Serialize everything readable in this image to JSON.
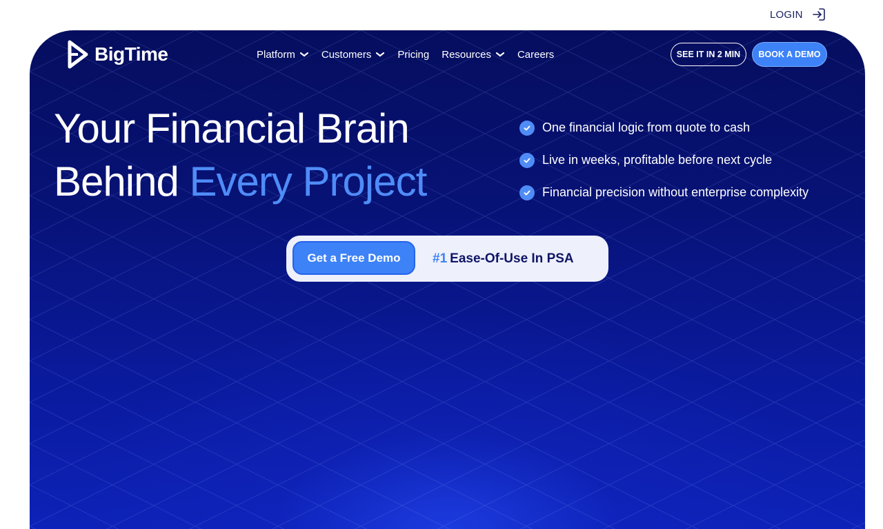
{
  "topbar": {
    "login_label": "LOGIN",
    "login_icon": "login-arrow-icon"
  },
  "brand": {
    "name": "BigTime",
    "logo_icon": "bigtime-play-logo-icon"
  },
  "nav": {
    "items": [
      {
        "label": "Platform",
        "has_dropdown": true
      },
      {
        "label": "Customers",
        "has_dropdown": true
      },
      {
        "label": "Pricing",
        "has_dropdown": false
      },
      {
        "label": "Resources",
        "has_dropdown": true
      },
      {
        "label": "Careers",
        "has_dropdown": false
      }
    ],
    "see_it_label": "SEE IT IN 2 MIN",
    "book_demo_label": "BOOK A DEMO"
  },
  "hero": {
    "headline_line1": "Your Financial Brain",
    "headline_line2_plain": "Behind ",
    "headline_line2_accent": "Every Project",
    "checklist": [
      "One financial logic from quote to cash",
      "Live in weeks, profitable before next cycle",
      "Financial precision without enterprise complexity"
    ],
    "cta_button_label": "Get a Free Demo",
    "badge_rank": "#1",
    "badge_text": "Ease-Of-Use In PSA"
  },
  "colors": {
    "hero_bg": "#071276",
    "accent": "#4f8cf7",
    "button_blue": "#3d82f7",
    "navy_text": "#0f1565",
    "pill_bg": "#eef0fb"
  }
}
